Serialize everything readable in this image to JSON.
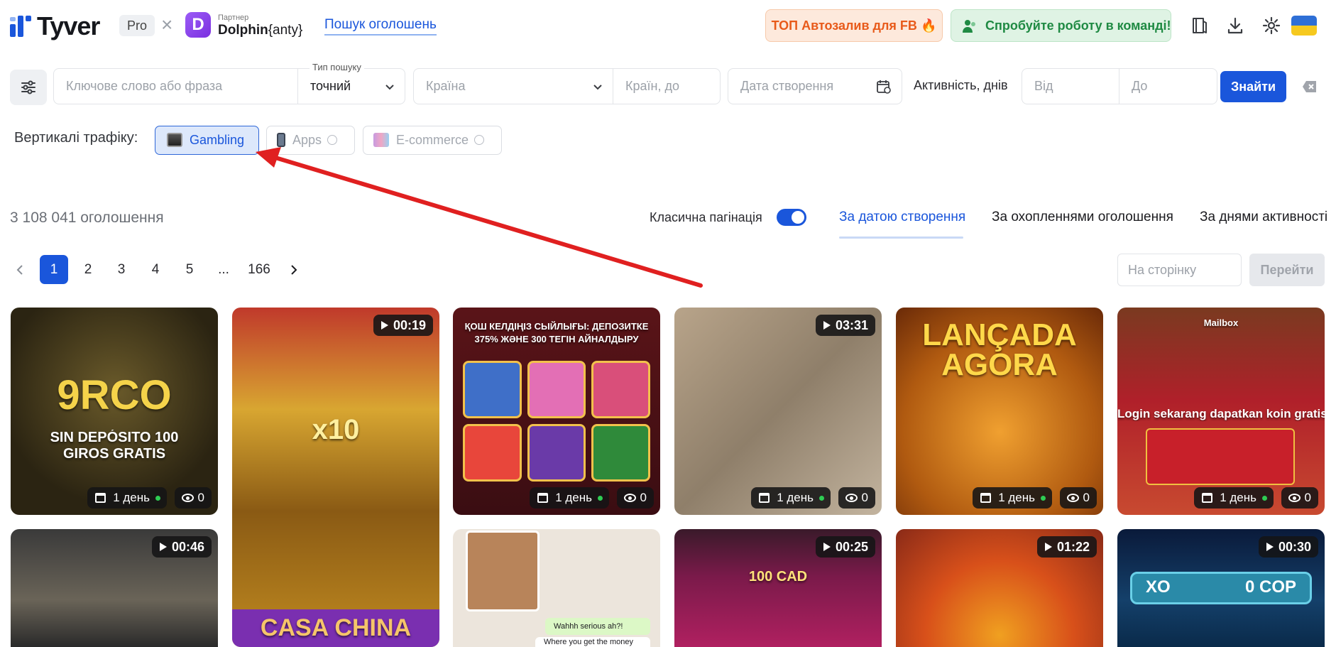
{
  "header": {
    "logo_text": "Tyver",
    "plan_badge": "Pro",
    "partner_label": "Партнер",
    "partner_name": "Dolphin",
    "partner_suffix": "{anty}",
    "nav_link": "Пошук оголошень",
    "promo_fb": "ТОП Автозалив для FB",
    "promo_team": "Спробуйте роботу в команді!",
    "icons": [
      "book-icon",
      "download-icon",
      "gear-icon",
      "ukraine-flag-icon"
    ],
    "colors": {
      "accent": "#1a56db",
      "promo_fb": "#e85a1a",
      "promo_team": "#1f8a43"
    }
  },
  "search": {
    "keyword_placeholder": "Ключове слово або фраза",
    "search_type_label": "Тип пошуку",
    "search_type_value": "точний",
    "country_placeholder": "Країна",
    "countries_to_placeholder": "Країн, до",
    "date_placeholder": "Дата створення",
    "activity_label": "Активність, днів",
    "from_placeholder": "Від",
    "to_placeholder": "До",
    "find_label": "Знайти"
  },
  "verticals": {
    "label": "Вертикалі трафіку:",
    "items": [
      {
        "label": "Gambling",
        "active": true
      },
      {
        "label": "Apps",
        "active": false
      },
      {
        "label": "E-commerce",
        "active": false
      }
    ]
  },
  "results": {
    "total": "3 108 041 оголошення",
    "classic_pagination_label": "Класична пагінація",
    "classic_pagination_on": true,
    "sort_tabs": [
      {
        "label": "За датою створення",
        "active": true
      },
      {
        "label": "За охопленнями оголошення",
        "active": false
      },
      {
        "label": "За днями активності",
        "active": false
      }
    ]
  },
  "pagination": {
    "pages": [
      "1",
      "2",
      "3",
      "4",
      "5",
      "...",
      "166"
    ],
    "current": "1",
    "goto_placeholder": "На сторінку",
    "goto_label": "Перейти"
  },
  "cards": [
    {
      "title": "9RCO",
      "subtitle": "SIN DEPÓSITO 100 GIROS GRATIS",
      "duration": "",
      "days": "1 день",
      "views": "0"
    },
    {
      "title": "x10",
      "subtitle": "CASA CHINA",
      "duration": "00:19",
      "days": "",
      "views": ""
    },
    {
      "title": "ҚОШ КЕЛДІҢІЗ СЫЙЛЫҒЫ: ДЕПОЗИТКЕ 375% ЖӘНЕ 300 ТЕГІН АЙНАЛДЫРУ",
      "subtitle": "",
      "duration": "",
      "days": "1 день",
      "views": "0"
    },
    {
      "title": "",
      "subtitle": "",
      "duration": "03:31",
      "days": "1 день",
      "views": "0"
    },
    {
      "title": "LANÇADA AGORA",
      "subtitle": "",
      "duration": "",
      "days": "1 день",
      "views": "0"
    },
    {
      "title": "Login sekarang dapatkan koin gratis",
      "subtitle": "Mailbox",
      "duration": "",
      "days": "1 день",
      "views": "0"
    },
    {
      "title": "",
      "subtitle": "",
      "duration": "00:46",
      "days": "",
      "views": ""
    },
    {
      "title": "Wahhh serious ah?!",
      "subtitle": "Where you get the money",
      "duration": "",
      "days": "",
      "views": ""
    },
    {
      "title": "100 CAD",
      "subtitle": "",
      "duration": "00:25",
      "days": "",
      "views": ""
    },
    {
      "title": "",
      "subtitle": "",
      "duration": "01:22",
      "days": "",
      "views": ""
    },
    {
      "title": "XO",
      "subtitle": "0 COP",
      "duration": "00:30",
      "days": "",
      "views": ""
    }
  ]
}
